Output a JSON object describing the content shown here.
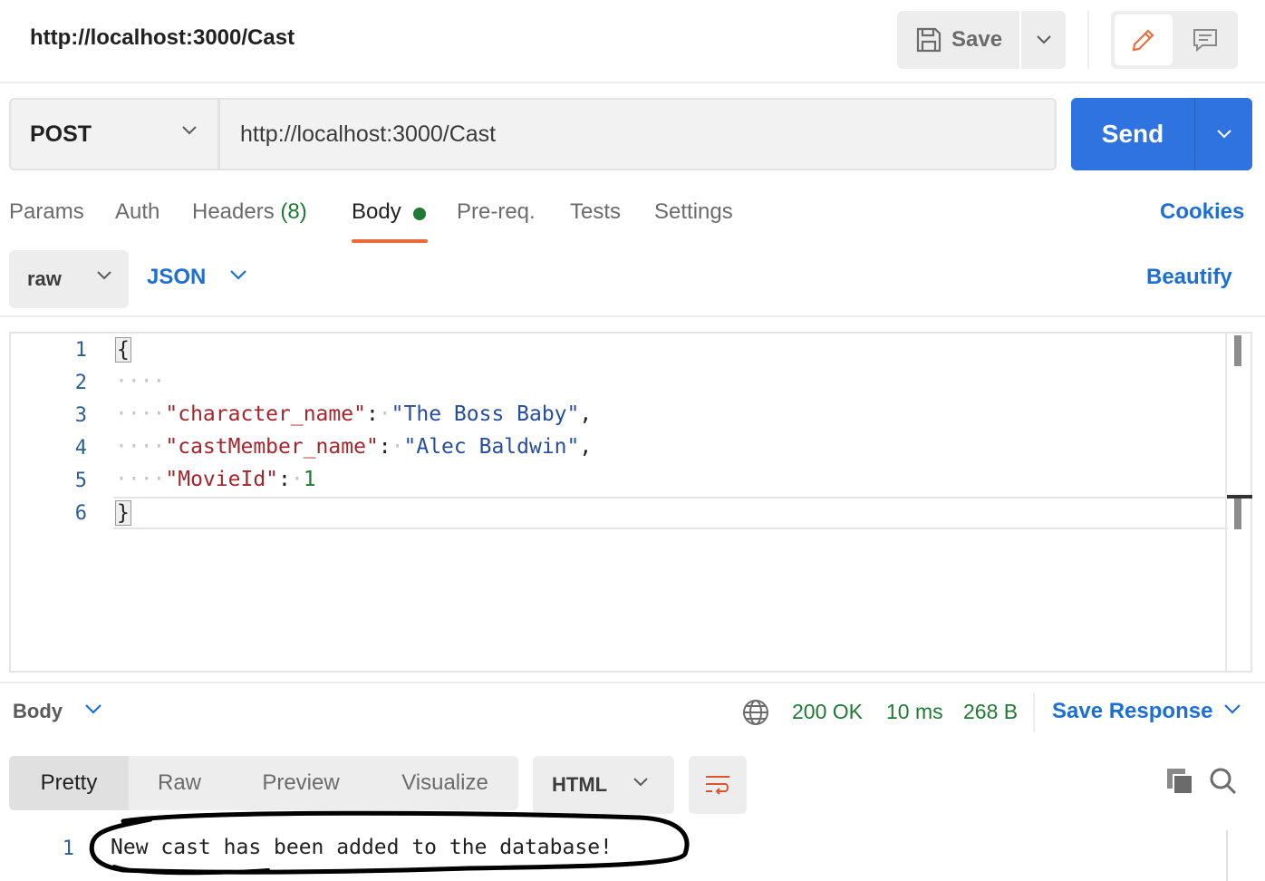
{
  "header": {
    "title": "http://localhost:3000/Cast",
    "save_label": "Save"
  },
  "request": {
    "method": "POST",
    "url": "http://localhost:3000/Cast",
    "send_label": "Send"
  },
  "tabs": {
    "params": "Params",
    "auth": "Auth",
    "headers": "Headers",
    "headers_count": "(8)",
    "body": "Body",
    "prereq": "Pre-req.",
    "tests": "Tests",
    "settings": "Settings",
    "cookies": "Cookies"
  },
  "body_options": {
    "mode": "raw",
    "language": "JSON",
    "beautify": "Beautify"
  },
  "editor": {
    "line_numbers": [
      "1",
      "2",
      "3",
      "4",
      "5",
      "6"
    ],
    "lines": [
      {
        "key": "\"character_name\"",
        "value": "\"The Boss Baby\""
      },
      {
        "key": "\"castMember_name\"",
        "value": "\"Alec Baldwin\""
      },
      {
        "key": "\"MovieId\"",
        "value": "1"
      }
    ]
  },
  "response": {
    "body_label": "Body",
    "status": "200 OK",
    "time": "10 ms",
    "size": "268 B",
    "save_response": "Save Response",
    "view_tabs": {
      "pretty": "Pretty",
      "raw": "Raw",
      "preview": "Preview",
      "visualize": "Visualize"
    },
    "format": "HTML",
    "line_number": "1",
    "content": "New cast has been added to the database!"
  },
  "colors": {
    "accent": "#2f73e0",
    "link": "#1e6fd4",
    "success": "#1f7a34",
    "active_tab": "#ec6b3b",
    "json_key": "#a4262c",
    "json_string": "#264d9e"
  },
  "icons": [
    "save-icon",
    "chevron-down-icon",
    "pencil-icon",
    "comment-icon",
    "globe-icon",
    "wrap-icon",
    "copy-icon",
    "search-icon"
  ]
}
